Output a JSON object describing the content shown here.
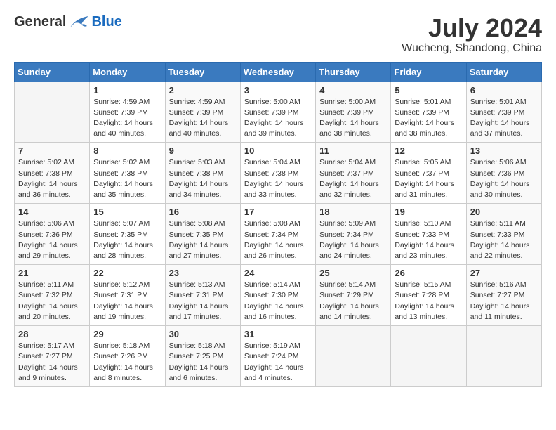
{
  "header": {
    "logo_general": "General",
    "logo_blue": "Blue",
    "month_title": "July 2024",
    "location": "Wucheng, Shandong, China"
  },
  "days_of_week": [
    "Sunday",
    "Monday",
    "Tuesday",
    "Wednesday",
    "Thursday",
    "Friday",
    "Saturday"
  ],
  "weeks": [
    [
      {
        "day": "",
        "info": ""
      },
      {
        "day": "1",
        "info": "Sunrise: 4:59 AM\nSunset: 7:39 PM\nDaylight: 14 hours\nand 40 minutes."
      },
      {
        "day": "2",
        "info": "Sunrise: 4:59 AM\nSunset: 7:39 PM\nDaylight: 14 hours\nand 40 minutes."
      },
      {
        "day": "3",
        "info": "Sunrise: 5:00 AM\nSunset: 7:39 PM\nDaylight: 14 hours\nand 39 minutes."
      },
      {
        "day": "4",
        "info": "Sunrise: 5:00 AM\nSunset: 7:39 PM\nDaylight: 14 hours\nand 38 minutes."
      },
      {
        "day": "5",
        "info": "Sunrise: 5:01 AM\nSunset: 7:39 PM\nDaylight: 14 hours\nand 38 minutes."
      },
      {
        "day": "6",
        "info": "Sunrise: 5:01 AM\nSunset: 7:39 PM\nDaylight: 14 hours\nand 37 minutes."
      }
    ],
    [
      {
        "day": "7",
        "info": "Sunrise: 5:02 AM\nSunset: 7:38 PM\nDaylight: 14 hours\nand 36 minutes."
      },
      {
        "day": "8",
        "info": "Sunrise: 5:02 AM\nSunset: 7:38 PM\nDaylight: 14 hours\nand 35 minutes."
      },
      {
        "day": "9",
        "info": "Sunrise: 5:03 AM\nSunset: 7:38 PM\nDaylight: 14 hours\nand 34 minutes."
      },
      {
        "day": "10",
        "info": "Sunrise: 5:04 AM\nSunset: 7:38 PM\nDaylight: 14 hours\nand 33 minutes."
      },
      {
        "day": "11",
        "info": "Sunrise: 5:04 AM\nSunset: 7:37 PM\nDaylight: 14 hours\nand 32 minutes."
      },
      {
        "day": "12",
        "info": "Sunrise: 5:05 AM\nSunset: 7:37 PM\nDaylight: 14 hours\nand 31 minutes."
      },
      {
        "day": "13",
        "info": "Sunrise: 5:06 AM\nSunset: 7:36 PM\nDaylight: 14 hours\nand 30 minutes."
      }
    ],
    [
      {
        "day": "14",
        "info": "Sunrise: 5:06 AM\nSunset: 7:36 PM\nDaylight: 14 hours\nand 29 minutes."
      },
      {
        "day": "15",
        "info": "Sunrise: 5:07 AM\nSunset: 7:35 PM\nDaylight: 14 hours\nand 28 minutes."
      },
      {
        "day": "16",
        "info": "Sunrise: 5:08 AM\nSunset: 7:35 PM\nDaylight: 14 hours\nand 27 minutes."
      },
      {
        "day": "17",
        "info": "Sunrise: 5:08 AM\nSunset: 7:34 PM\nDaylight: 14 hours\nand 26 minutes."
      },
      {
        "day": "18",
        "info": "Sunrise: 5:09 AM\nSunset: 7:34 PM\nDaylight: 14 hours\nand 24 minutes."
      },
      {
        "day": "19",
        "info": "Sunrise: 5:10 AM\nSunset: 7:33 PM\nDaylight: 14 hours\nand 23 minutes."
      },
      {
        "day": "20",
        "info": "Sunrise: 5:11 AM\nSunset: 7:33 PM\nDaylight: 14 hours\nand 22 minutes."
      }
    ],
    [
      {
        "day": "21",
        "info": "Sunrise: 5:11 AM\nSunset: 7:32 PM\nDaylight: 14 hours\nand 20 minutes."
      },
      {
        "day": "22",
        "info": "Sunrise: 5:12 AM\nSunset: 7:31 PM\nDaylight: 14 hours\nand 19 minutes."
      },
      {
        "day": "23",
        "info": "Sunrise: 5:13 AM\nSunset: 7:31 PM\nDaylight: 14 hours\nand 17 minutes."
      },
      {
        "day": "24",
        "info": "Sunrise: 5:14 AM\nSunset: 7:30 PM\nDaylight: 14 hours\nand 16 minutes."
      },
      {
        "day": "25",
        "info": "Sunrise: 5:14 AM\nSunset: 7:29 PM\nDaylight: 14 hours\nand 14 minutes."
      },
      {
        "day": "26",
        "info": "Sunrise: 5:15 AM\nSunset: 7:28 PM\nDaylight: 14 hours\nand 13 minutes."
      },
      {
        "day": "27",
        "info": "Sunrise: 5:16 AM\nSunset: 7:27 PM\nDaylight: 14 hours\nand 11 minutes."
      }
    ],
    [
      {
        "day": "28",
        "info": "Sunrise: 5:17 AM\nSunset: 7:27 PM\nDaylight: 14 hours\nand 9 minutes."
      },
      {
        "day": "29",
        "info": "Sunrise: 5:18 AM\nSunset: 7:26 PM\nDaylight: 14 hours\nand 8 minutes."
      },
      {
        "day": "30",
        "info": "Sunrise: 5:18 AM\nSunset: 7:25 PM\nDaylight: 14 hours\nand 6 minutes."
      },
      {
        "day": "31",
        "info": "Sunrise: 5:19 AM\nSunset: 7:24 PM\nDaylight: 14 hours\nand 4 minutes."
      },
      {
        "day": "",
        "info": ""
      },
      {
        "day": "",
        "info": ""
      },
      {
        "day": "",
        "info": ""
      }
    ]
  ]
}
